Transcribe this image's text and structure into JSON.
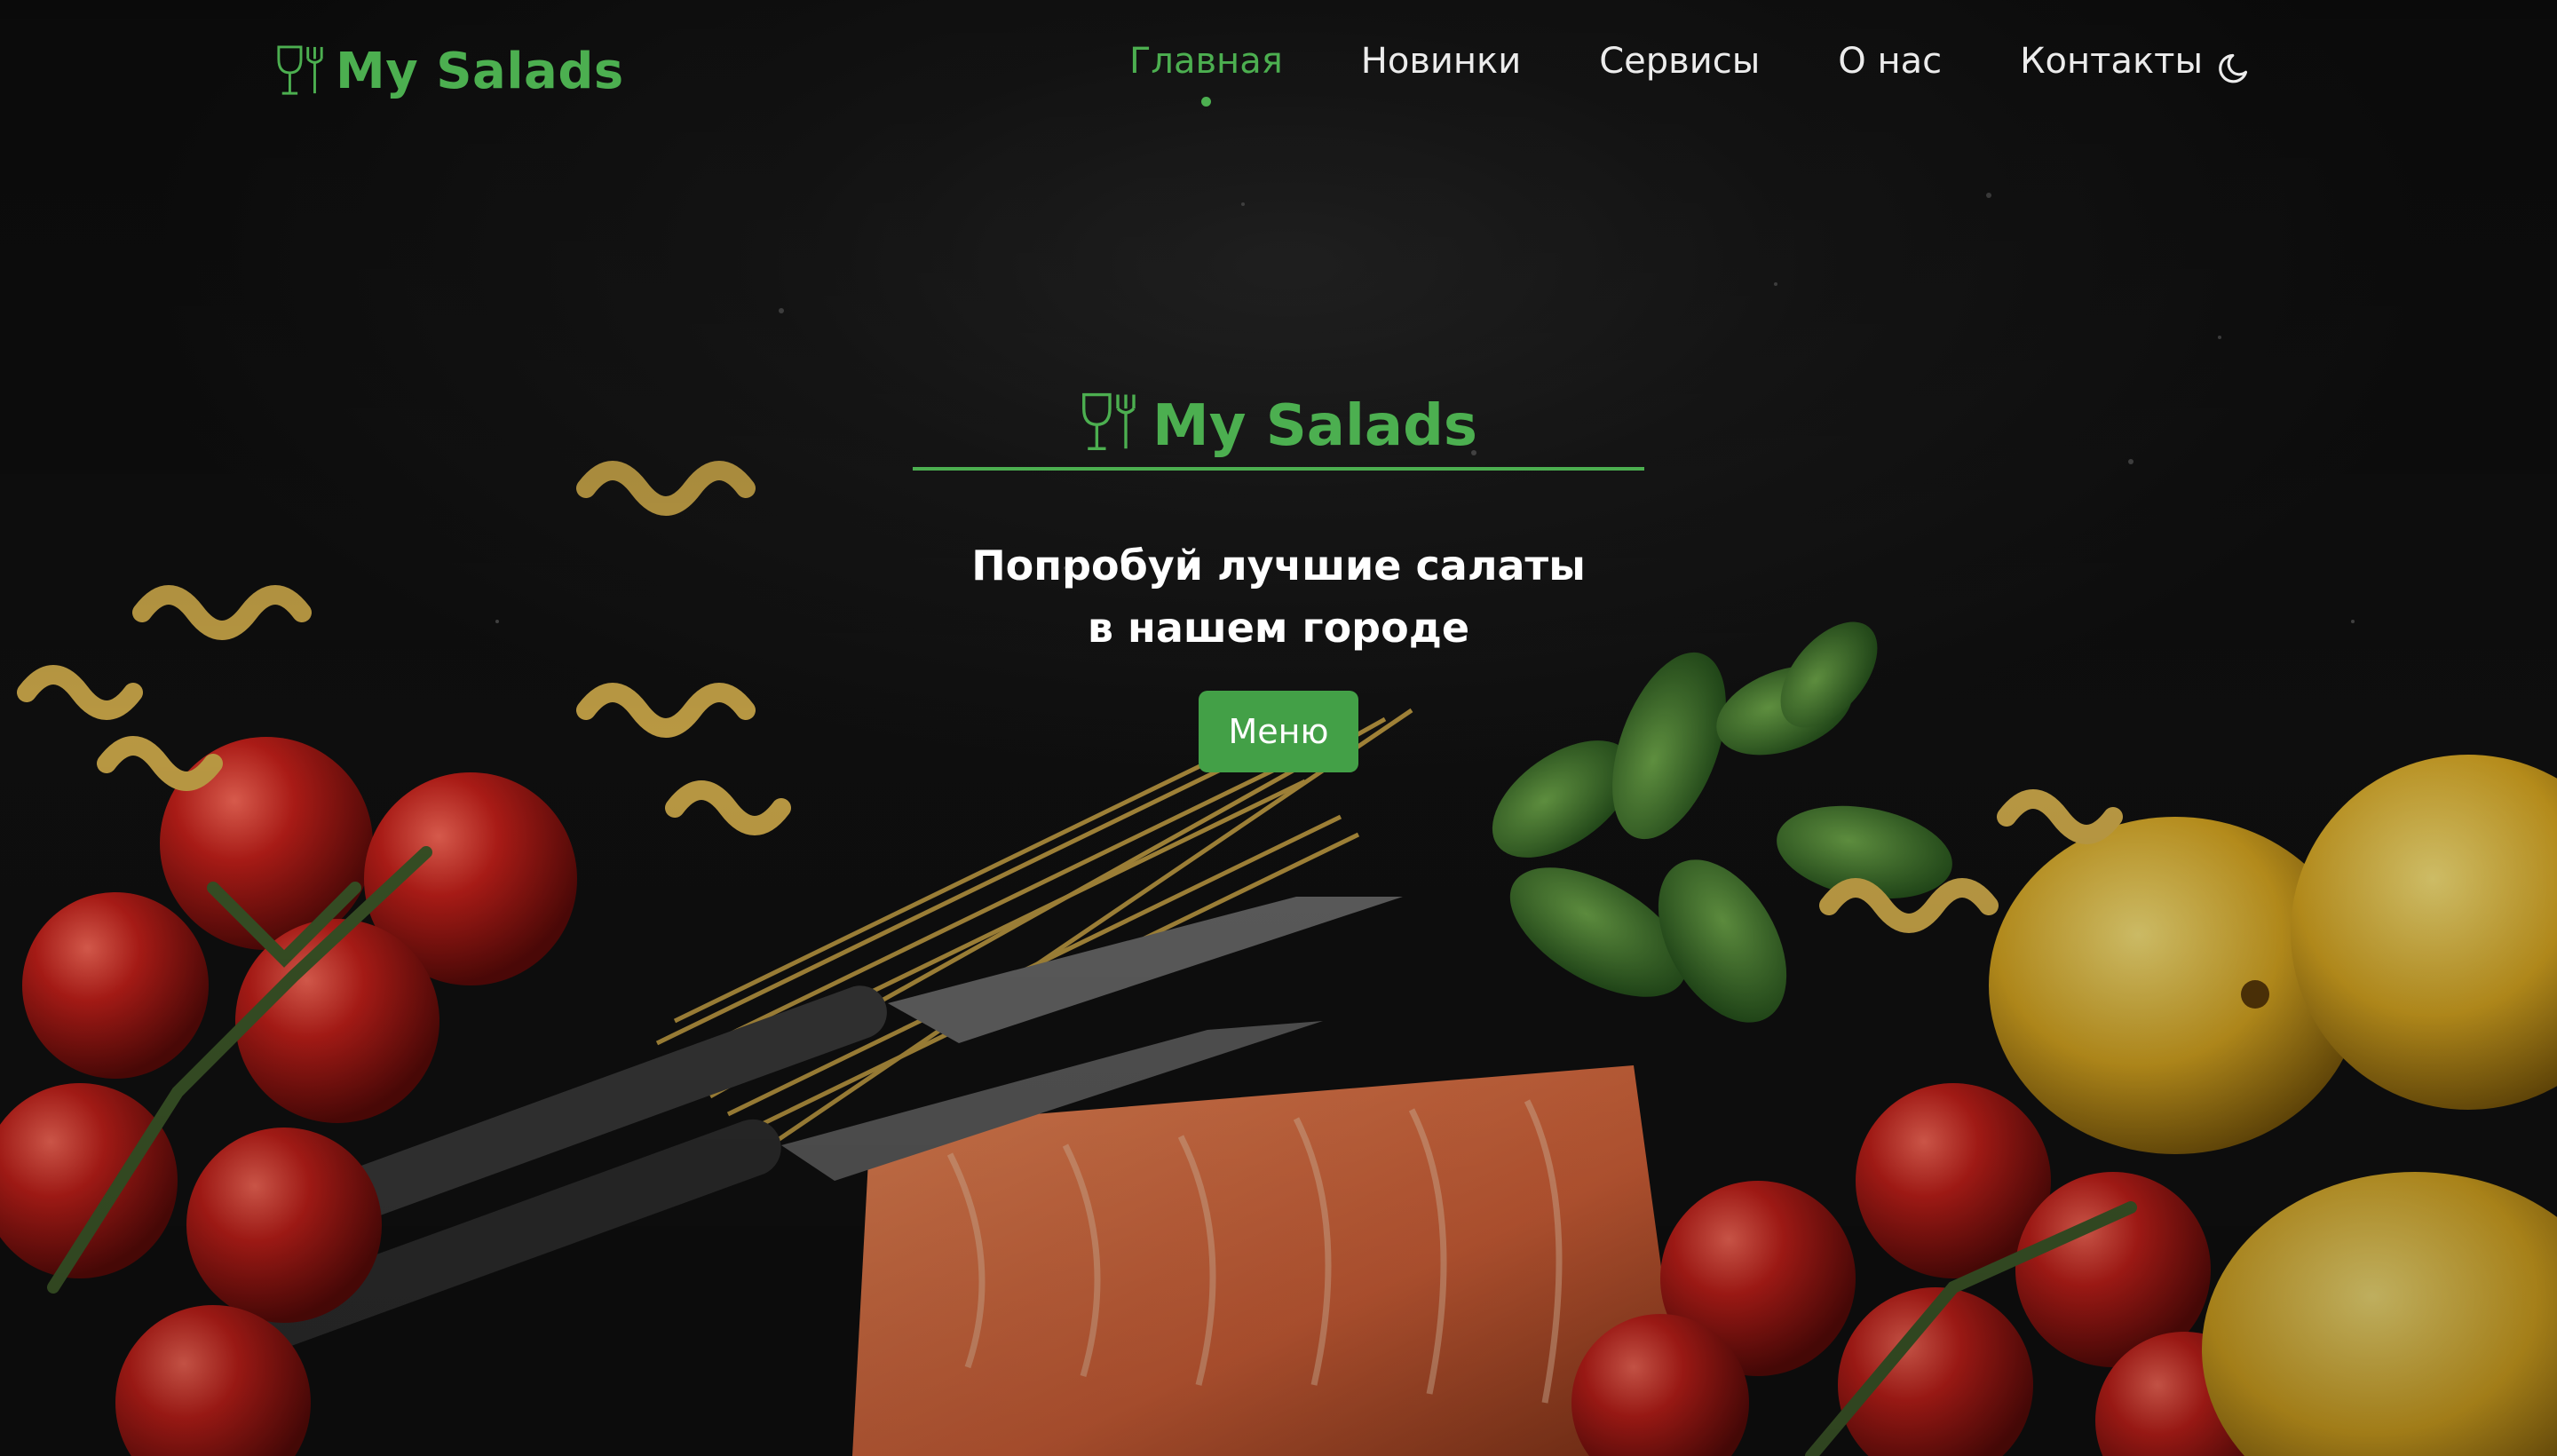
{
  "brand": {
    "name": "My Salads"
  },
  "nav": {
    "items": [
      {
        "label": "Главная",
        "active": true
      },
      {
        "label": "Новинки",
        "active": false
      },
      {
        "label": "Сервисы",
        "active": false
      },
      {
        "label": "О нас",
        "active": false
      },
      {
        "label": "Контакты",
        "active": false
      }
    ],
    "theme_toggle_icon": "moon-icon"
  },
  "hero": {
    "brand_name": "My Salads",
    "tagline_line1": "Попробуй лучшие салаты",
    "tagline_line2": "в нашем городе",
    "menu_button_label": "Меню"
  },
  "colors": {
    "accent": "#4caf50",
    "button": "#43a047",
    "background": "#141414",
    "nav_text": "#ececec"
  }
}
